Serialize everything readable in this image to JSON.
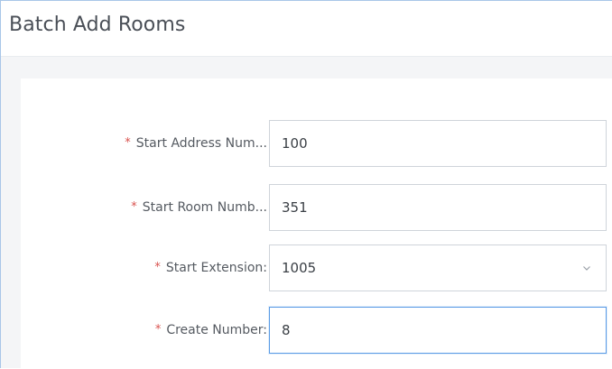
{
  "dialog": {
    "title": "Batch Add Rooms"
  },
  "form": {
    "fields": [
      {
        "label": "Start Address Num...",
        "value": "100",
        "required": true,
        "type": "text"
      },
      {
        "label": "Start Room Numb...",
        "value": "351",
        "required": true,
        "type": "text"
      },
      {
        "label": "Start Extension:",
        "value": "1005",
        "required": true,
        "type": "select",
        "icon": "chevron-down-icon"
      },
      {
        "label": "Create Number:",
        "value": "8",
        "required": true,
        "type": "text",
        "focused": true
      }
    ],
    "required_marker": "*"
  },
  "colors": {
    "title_text": "#4a4f57",
    "label_text": "#555a61",
    "required_star": "#d9534f",
    "input_border": "#cfd4da",
    "focused_border": "#5a9be6",
    "panel_background": "#f4f5f7"
  }
}
